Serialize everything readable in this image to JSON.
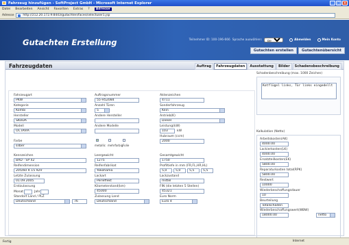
{
  "window": {
    "title": "Fahrzeug hinzufügen - SoftProject GmbH - Microsoft Internet Explorer"
  },
  "menu": [
    "Datei",
    "Bearbeiten",
    "Ansicht",
    "Favoriten",
    "Extras",
    "?"
  ],
  "menu_toolbar_label": "Adresse",
  "address": {
    "label": "Adresse",
    "url": "http://212.20.172.9:8443/gutachten/faces/selectuser1.jsp"
  },
  "header": {
    "title": "Gutachten Erstellung",
    "user_text": "Teilnehmer ID: 100-196-666",
    "lang_label": "Sprache auswählen:",
    "lang_value": "Deutsch",
    "logout": "Abmelden",
    "account": "Mein Konto",
    "nav": [
      "Gutachten erstellen",
      "Gutachtenübersicht"
    ]
  },
  "page": {
    "title": "Fahrzeugdaten",
    "tabs": [
      {
        "label": "Auftrag",
        "active": false
      },
      {
        "label": "Fahrzeugdaten",
        "active": true
      },
      {
        "label": "Ausstattung",
        "active": false
      },
      {
        "label": "Bilder",
        "active": false
      },
      {
        "label": "Schadensbeschreibung",
        "active": false
      }
    ]
  },
  "form": {
    "fahrzeugart": {
      "label": "Fahrzeugart",
      "value": "PKW"
    },
    "auftragsnummer": {
      "label": "Auftragsnummer",
      "value": "55-H52084"
    },
    "aktenzeichen": {
      "label": "Aktenzeichen",
      "value": "4711"
    },
    "kategorie": {
      "label": "Kategorie",
      "value": "Kombi"
    },
    "anzahl_tueren": {
      "label": "Anzahl Türen",
      "value": "5"
    },
    "sonderfahrzeug": {
      "label": "Sonderfahrzeug",
      "value": "Kein"
    },
    "hersteller": {
      "label": "Hersteller",
      "value": "SKODA"
    },
    "andere_hersteller": {
      "label": "Andere Hersteller",
      "value": ""
    },
    "antrieb": {
      "label": "Antrieb(K)",
      "value": "Diesel"
    },
    "modell": {
      "label": "Modell",
      "value": "OCTAVIA"
    },
    "andere_modelle": {
      "label": "Andere Modelle",
      "value": ""
    },
    "leistung": {
      "label": "Leistung(kW)",
      "value": "103",
      "unit": "kW"
    },
    "hubraum": {
      "label": "Hubraum (ccm)",
      "value": "2000"
    },
    "farbe": {
      "label": "Farbe",
      "value": "silber"
    },
    "checks": [
      {
        "label": "metallic",
        "on": true
      },
      {
        "label": "mehrfarbig",
        "on": false
      },
      {
        "label": "Folie",
        "on": false
      }
    ],
    "kennzeichen": {
      "label": "Kennzeichen",
      "value": "BAD - SP 42"
    },
    "leergewicht": {
      "label": "Leergewicht",
      "value": "1275"
    },
    "gesamtgewicht": {
      "label": "Gesamtgewicht",
      "value": "1750"
    },
    "reifendimension": {
      "label": "Reifendimension",
      "value": "205/60 R 15 92V"
    },
    "reifenfabrikat": {
      "label": "Reifenfabrikat",
      "value": "Yokohama"
    },
    "profiltiefe": {
      "label": "Profiltiefe in mm (FR,FL,HR,HL)",
      "values": [
        "5,0",
        "5,0",
        "5,5",
        "5,5"
      ]
    },
    "letzte_zulassung": {
      "label": "Letzte Zulassung",
      "value": "01.09.2005"
    },
    "lackart": {
      "label": "Lackart",
      "value": "Perleffekt"
    },
    "lackzustand": {
      "label": "Lackzustand",
      "value": "mittel"
    },
    "erstzulassung": {
      "label": "Erstzulassung",
      "monat": "Monat",
      "jahr": "Jahr"
    },
    "km_stand": {
      "label": "Kilometerstand(km)",
      "value": "45000"
    },
    "fin": {
      "label": "FIN (die letzten 5 Stellen)",
      "value": "45321"
    },
    "standort": {
      "label": "Standort Land / PLZ",
      "value": "Deutschland",
      "plz": "76"
    },
    "zulassung_land": {
      "label": "Zulassung Land",
      "value": "Deutschland"
    },
    "euro_norm": {
      "label": "Euro Norm",
      "value": "Euro 4"
    }
  },
  "right": {
    "beschreibung_label": "Schadenbeschreibung (max. 1000 Zeichen)",
    "beschreibung_text": "Kotflügel links, Tür links eingedellt",
    "kalkulation_label": "Kalkulation (Netto)",
    "rows": [
      {
        "label": "Arbeitskosten(AK)",
        "value": "4000.00"
      },
      {
        "label": "Lackierkosten(LK)",
        "value": "4000.00"
      },
      {
        "label": "Ersatzteilkosten(EK)",
        "value": "5800.00"
      },
      {
        "label": "Reparaturkosten total(RPK)",
        "value": "5800.00"
      },
      {
        "label": "Restwert",
        "value": "10000"
      },
      {
        "label": "Wiederbeschaffungsdauer",
        "value": "10"
      },
      {
        "label": "Beurteilung",
        "value": "Totalschaden"
      },
      {
        "label": "Wiederbeschaffungswert(WBW)",
        "value": "18000.00",
        "extra": "netto"
      }
    ]
  },
  "status": {
    "left": "Fertig",
    "zone": "Internet"
  }
}
